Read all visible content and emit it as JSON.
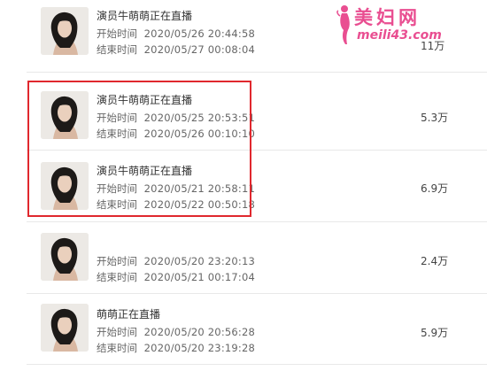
{
  "watermark": {
    "name": "美妇网",
    "url": "meili43.com"
  },
  "list": {
    "rows": [
      {
        "title": "演员牛萌萌正在直播",
        "start_label": "开始时间",
        "start_value": "2020/05/26 20:44:58",
        "end_label": "结束时间",
        "end_value": "2020/05/27 00:08:04",
        "count": "11万"
      },
      {
        "title": "演员牛萌萌正在直播",
        "start_label": "开始时间",
        "start_value": "2020/05/25 20:53:51",
        "end_label": "结束时间",
        "end_value": "2020/05/26 00:10:10",
        "count": "5.3万"
      },
      {
        "title": "演员牛萌萌正在直播",
        "start_label": "开始时间",
        "start_value": "2020/05/21 20:58:11",
        "end_label": "结束时间",
        "end_value": "2020/05/22 00:50:18",
        "count": "6.9万"
      },
      {
        "title": "",
        "start_label": "开始时间",
        "start_value": "2020/05/20 23:20:13",
        "end_label": "结束时间",
        "end_value": "2020/05/21 00:17:04",
        "count": "2.4万"
      },
      {
        "title": "萌萌正在直播",
        "start_label": "开始时间",
        "start_value": "2020/05/20 20:56:28",
        "end_label": "结束时间",
        "end_value": "2020/05/20 23:19:28",
        "count": "5.9万"
      }
    ]
  },
  "colors": {
    "highlight": "#e0282e",
    "watermark": "#e94e91",
    "divider": "#e8e8e8"
  }
}
